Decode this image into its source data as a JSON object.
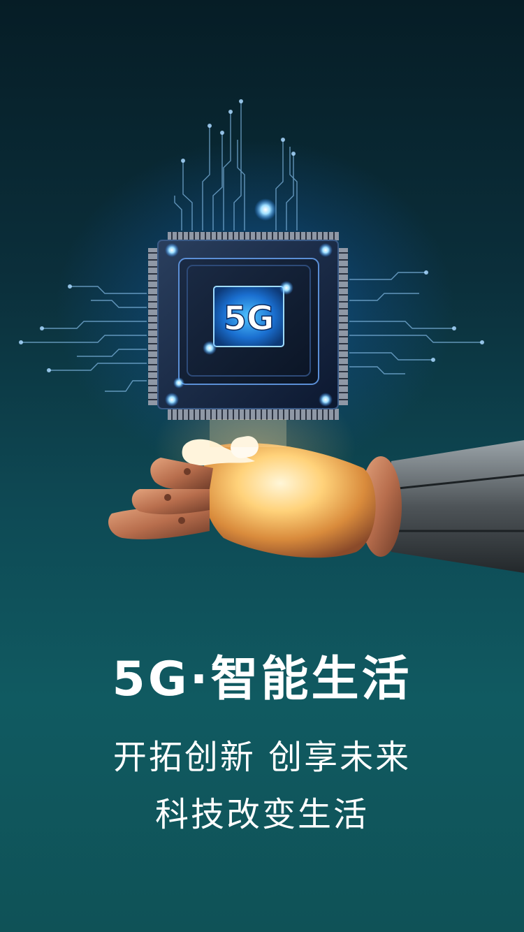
{
  "poster": {
    "chip_label": "5G",
    "headline": "5G·智能生活",
    "subline_1": "开拓创新 创享未来",
    "subline_2": "科技改变生活"
  },
  "colors": {
    "background_top": "#061d26",
    "background_bottom": "#0f5257",
    "glow_blue": "#1e90ff",
    "hand_glow": "#ffc766",
    "text": "#ffffff"
  }
}
